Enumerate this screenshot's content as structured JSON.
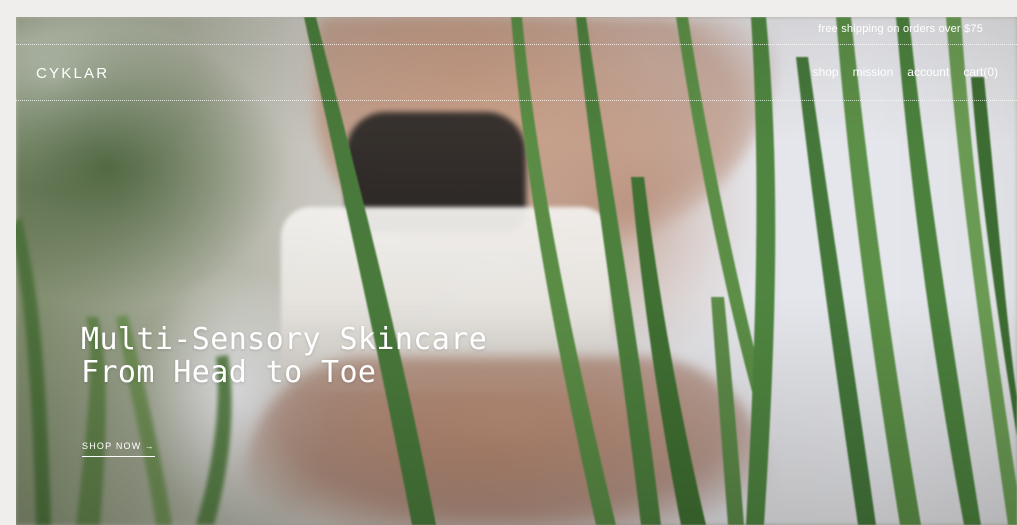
{
  "header": {
    "promo_text": "free shipping on orders over $75",
    "logo_text": "CYKLAR",
    "nav": {
      "shop": "shop",
      "mission": "mission",
      "account": "account",
      "cart_label": "cart",
      "cart_count": "(0)"
    }
  },
  "hero": {
    "headline_line1": "Multi-Sensory Skincare",
    "headline_line2": "From Head to Toe",
    "cta_label": "SHOP NOW",
    "cta_arrow": "→",
    "background_description": "blurred video still of hands holding a white jar behind grass blades"
  },
  "colors": {
    "page_background": "#efeeec",
    "text": "#ffffff",
    "grass": "#4f7a3c"
  }
}
